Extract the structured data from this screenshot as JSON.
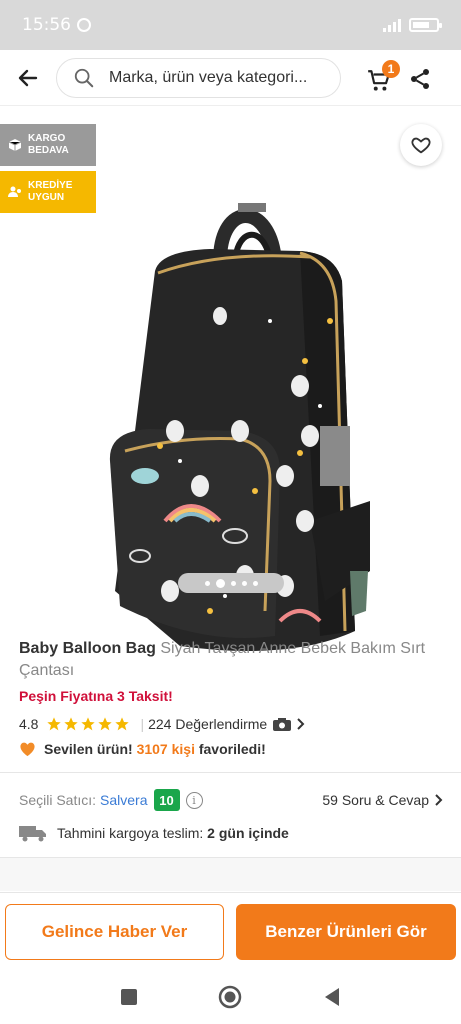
{
  "status_bar": {
    "time": "15:56"
  },
  "header": {
    "search_placeholder": "Marka, ürün veya kategori...",
    "cart_count": "1"
  },
  "gallery": {
    "tags": [
      {
        "label": "KARGO BEDAVA",
        "icon": "box-icon"
      },
      {
        "label": "KREDİYE UYGUN",
        "icon": "people-icon"
      }
    ],
    "image_count": 5,
    "active_image": 2
  },
  "product": {
    "brand": "Baby Balloon Bag",
    "name": "Siyah Tavşan Anne Bebek Bakım Sırt Çantası",
    "installment": "Peşin Fiyatına 3 Taksit!",
    "rating": "4.8",
    "stars": 5,
    "review_count": "224 Değerlendirme",
    "favorite_prefix": "Sevilen ürün!",
    "favorite_count": "3107 kişi",
    "favorite_suffix": "favoriledi!"
  },
  "seller": {
    "label": "Seçili Satıcı:",
    "name": "Salvera",
    "score": "10",
    "qa": "59 Soru & Cevap"
  },
  "delivery": {
    "label": "Tahmini kargoya teslim:",
    "value": "2 gün içinde"
  },
  "actions": {
    "notify": "Gelince Haber Ver",
    "similar": "Benzer Ürünleri Gör"
  },
  "colors": {
    "accent": "#f27a1a",
    "installment": "#d0103a",
    "seller_score": "#1aa64b",
    "seller_link": "#3a7bd5",
    "star": "#f5b800"
  }
}
